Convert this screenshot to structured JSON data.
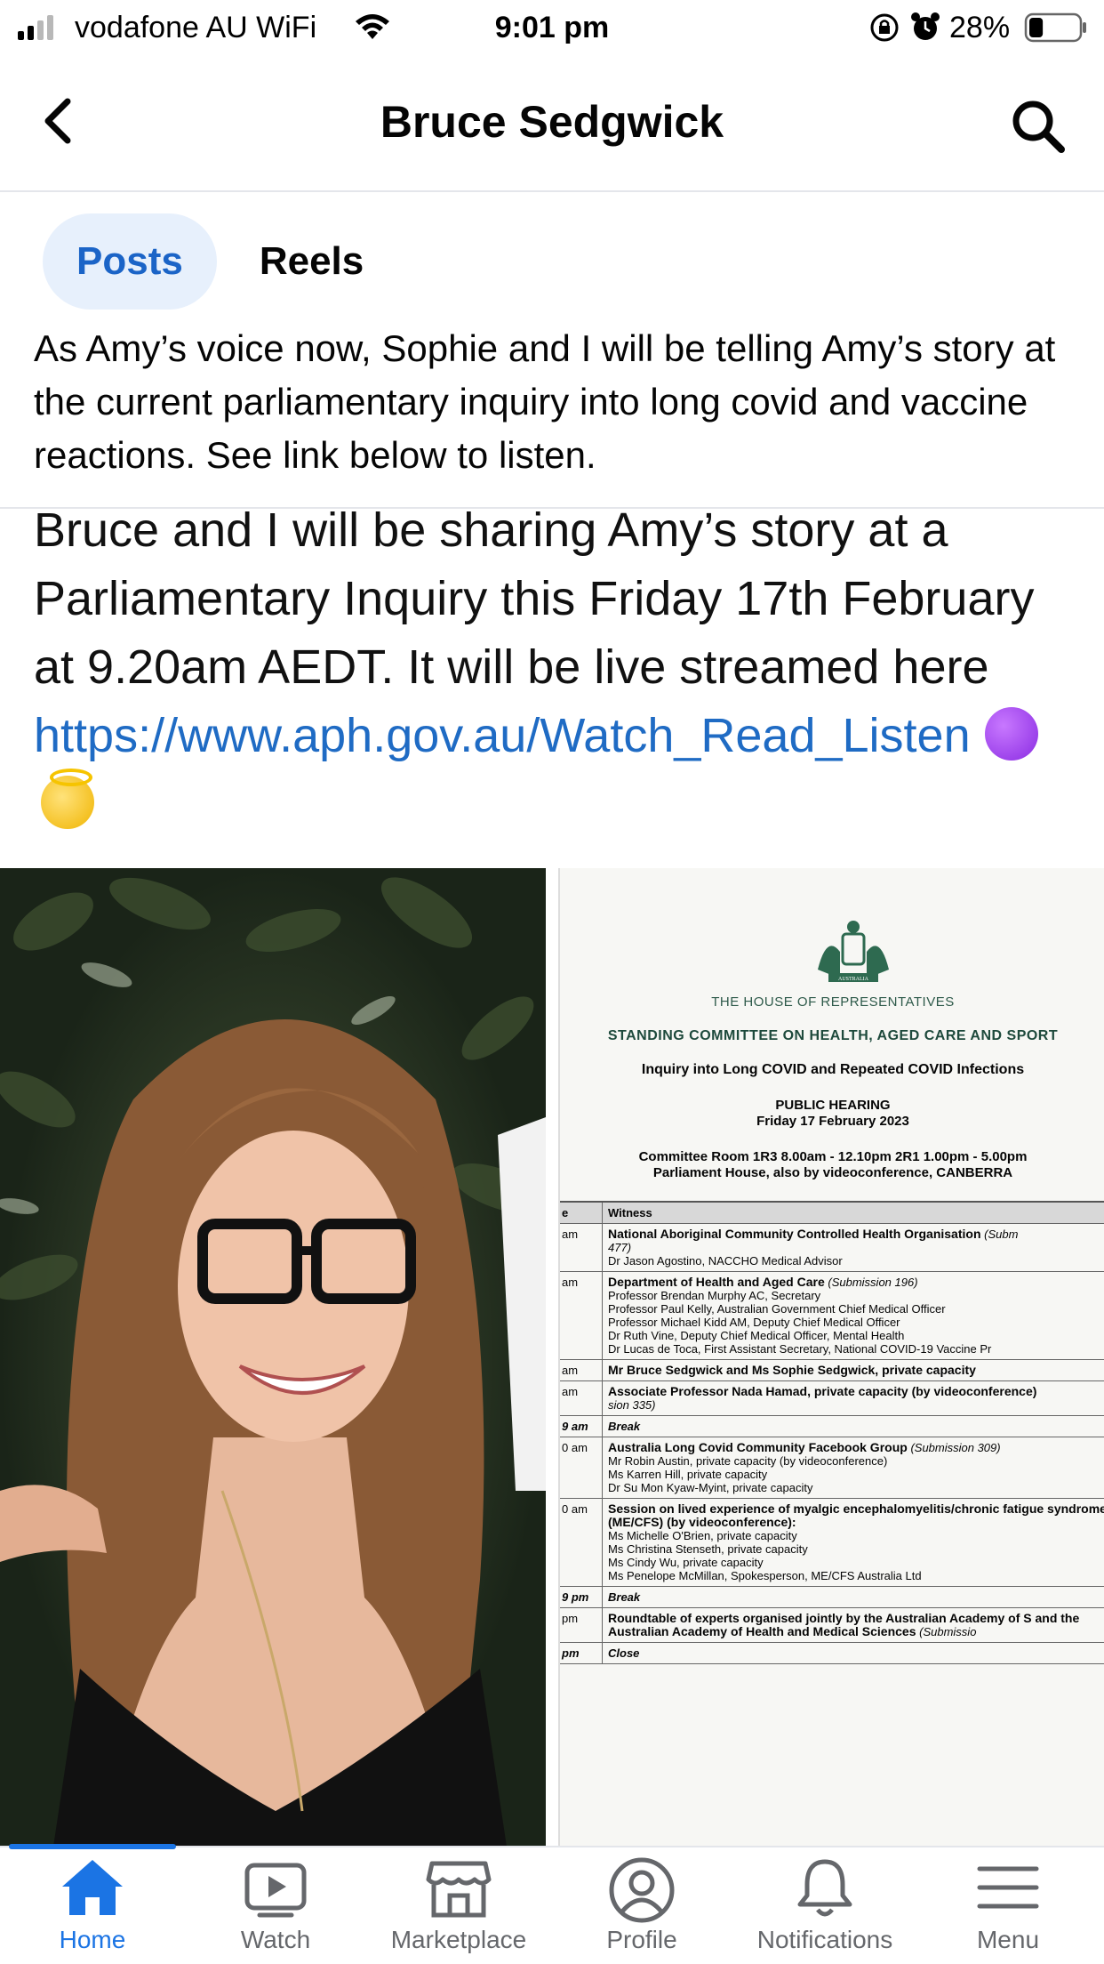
{
  "status_bar": {
    "carrier": "vodafone AU WiFi",
    "time": "9:01 pm",
    "battery_percent": "28%",
    "battery_level": 0.28
  },
  "header": {
    "title": "Bruce Sedgwick"
  },
  "tabs": [
    {
      "label": "Posts",
      "active": true
    },
    {
      "label": "Reels",
      "active": false
    }
  ],
  "post": {
    "text": "As Amy’s voice now, Sophie and I will be telling Amy’s story at the current parliamentary inquiry into long covid and vaccine reactions. See link below to listen."
  },
  "image": {
    "quote_text": "Bruce and I will be sharing Amy’s story at a Parliamentary Inquiry this Friday 17th February at 9.20am AEDT.  It will be live streamed here ",
    "quote_link": "https://www.aph.gov.au/Watch_Read_Listen",
    "document": {
      "crest_label": "AUSTRALIA",
      "house": "THE HOUSE OF REPRESENTATIVES",
      "committee": "STANDING COMMITTEE ON HEALTH, AGED CARE AND SPORT",
      "inquiry": "Inquiry into Long COVID and Repeated COVID Infections",
      "hearing": "PUBLIC HEARING",
      "date": "Friday 17 February 2023",
      "room": "Committee Room 1R3 8.00am - 12.10pm 2R1 1.00pm - 5.00pm",
      "location": "Parliament House, also by videoconference, CANBERRA",
      "table_header": {
        "time": "e",
        "witness": "Witness"
      },
      "rows": [
        {
          "time": "am",
          "title": "National Aboriginal Community Controlled Health Organisation",
          "submission": "(Subm",
          "lines": [
            "477)",
            "Dr Jason Agostino, NACCHO Medical Advisor"
          ]
        },
        {
          "time": "am",
          "title": "Department of Health and Aged Care",
          "submission": "(Submission 196)",
          "lines": [
            "Professor Brendan Murphy AC, Secretary",
            "Professor Paul Kelly, Australian Government Chief Medical Officer",
            "Professor Michael Kidd AM, Deputy Chief Medical Officer",
            "Dr Ruth Vine, Deputy Chief Medical Officer, Mental Health",
            "Dr Lucas de Toca, First Assistant Secretary, National COVID-19 Vaccine Pr"
          ]
        },
        {
          "time": "am",
          "title": "Mr Bruce Sedgwick and Ms Sophie Sedgwick, private capacity",
          "submission": "",
          "lines": []
        },
        {
          "time": "am",
          "title": "Associate Professor Nada Hamad, private capacity (by videoconference)",
          "submission": "",
          "lines": [
            "sion 335)"
          ]
        },
        {
          "time": "9 am",
          "title": "Break",
          "submission": "",
          "lines": [],
          "italic": true
        },
        {
          "time": "0 am",
          "title": "Australia Long Covid Community Facebook Group",
          "submission": "(Submission 309)",
          "lines": [
            "Mr Robin Austin, private capacity (by videoconference)",
            "Ms Karren Hill, private capacity",
            "Dr Su Mon Kyaw-Myint, private capacity"
          ]
        },
        {
          "time": "0 am",
          "title": "Session on lived experience of myalgic encephalomyelitis/chronic fatigue syndrome (ME/CFS) (by videoconference):",
          "submission": "",
          "lines": [
            "Ms Michelle O'Brien, private capacity",
            "Ms Christina Stenseth, private capacity",
            "Ms Cindy Wu, private capacity",
            "Ms Penelope McMillan, Spokesperson, ME/CFS Australia Ltd"
          ]
        },
        {
          "time": "9 pm",
          "title": "Break",
          "submission": "",
          "lines": [],
          "italic": true
        },
        {
          "time": "pm",
          "title": "Roundtable of experts organised jointly by the Australian Academy of S and the Australian Academy of Health and Medical Sciences",
          "submission": "(Submissio",
          "lines": []
        },
        {
          "time": "pm",
          "title": "Close",
          "submission": "",
          "lines": [],
          "italic": true
        }
      ]
    }
  },
  "bottom_nav": [
    {
      "label": "Home",
      "icon": "home-icon",
      "active": true
    },
    {
      "label": "Watch",
      "icon": "watch-icon",
      "active": false
    },
    {
      "label": "Marketplace",
      "icon": "marketplace-icon",
      "active": false
    },
    {
      "label": "Profile",
      "icon": "profile-icon",
      "active": false
    },
    {
      "label": "Notifications",
      "icon": "bell-icon",
      "active": false
    },
    {
      "label": "Menu",
      "icon": "menu-icon",
      "active": false
    }
  ],
  "colors": {
    "accent": "#1b74e4",
    "tab_active_bg": "#e7f0fc",
    "link": "#1f6bc4"
  }
}
